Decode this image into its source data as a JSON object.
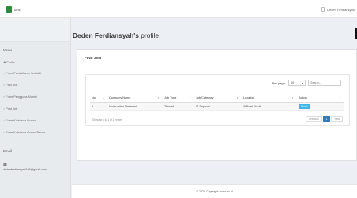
{
  "app": {
    "logo_text": "ums"
  },
  "header": {
    "user_name": "Deden Ferdiansyah"
  },
  "sidebar": {
    "menu_title": "Menu",
    "items": [
      {
        "label": "Profile",
        "bullet": "♟"
      },
      {
        "label": "Form Pendaftaran Softskill",
        "bullet": "○"
      },
      {
        "label": "Find Job",
        "bullet": "○"
      },
      {
        "label": "Form Pengguna Alumni",
        "bullet": "○"
      },
      {
        "label": "Post Job",
        "bullet": "○"
      },
      {
        "label": "Form Kuisioner Alumni",
        "bullet": "○"
      },
      {
        "label": "Form Kuisioner Alumni Pasca",
        "bullet": "○"
      }
    ],
    "email_title": "Email",
    "email": "dedenferdiansyah196@gmail.com"
  },
  "page": {
    "title_name": "Deden Ferdiansyah's",
    "title_rest": " profile"
  },
  "card": {
    "title": "FIND JOB",
    "per_page_label": "Per page:",
    "per_page_value": "10",
    "search_placeholder": "Search...",
    "columns": [
      "No",
      "Company Name",
      "Job Type",
      "Job Category",
      "Location",
      "Action"
    ],
    "rows": [
      {
        "no": "1",
        "company": "Universitas Nasional",
        "job_type": "Tetorial",
        "job_category": "IT Support",
        "location": "Jl Dewi Merik",
        "action": "Detail"
      }
    ],
    "showing": "Showing 1 to 1 of 1 entries",
    "pager": {
      "prev": "Previous",
      "current": "1",
      "next": "Next"
    }
  },
  "footer": {
    "text": "© 2020 Copyright: www.ac.id"
  }
}
